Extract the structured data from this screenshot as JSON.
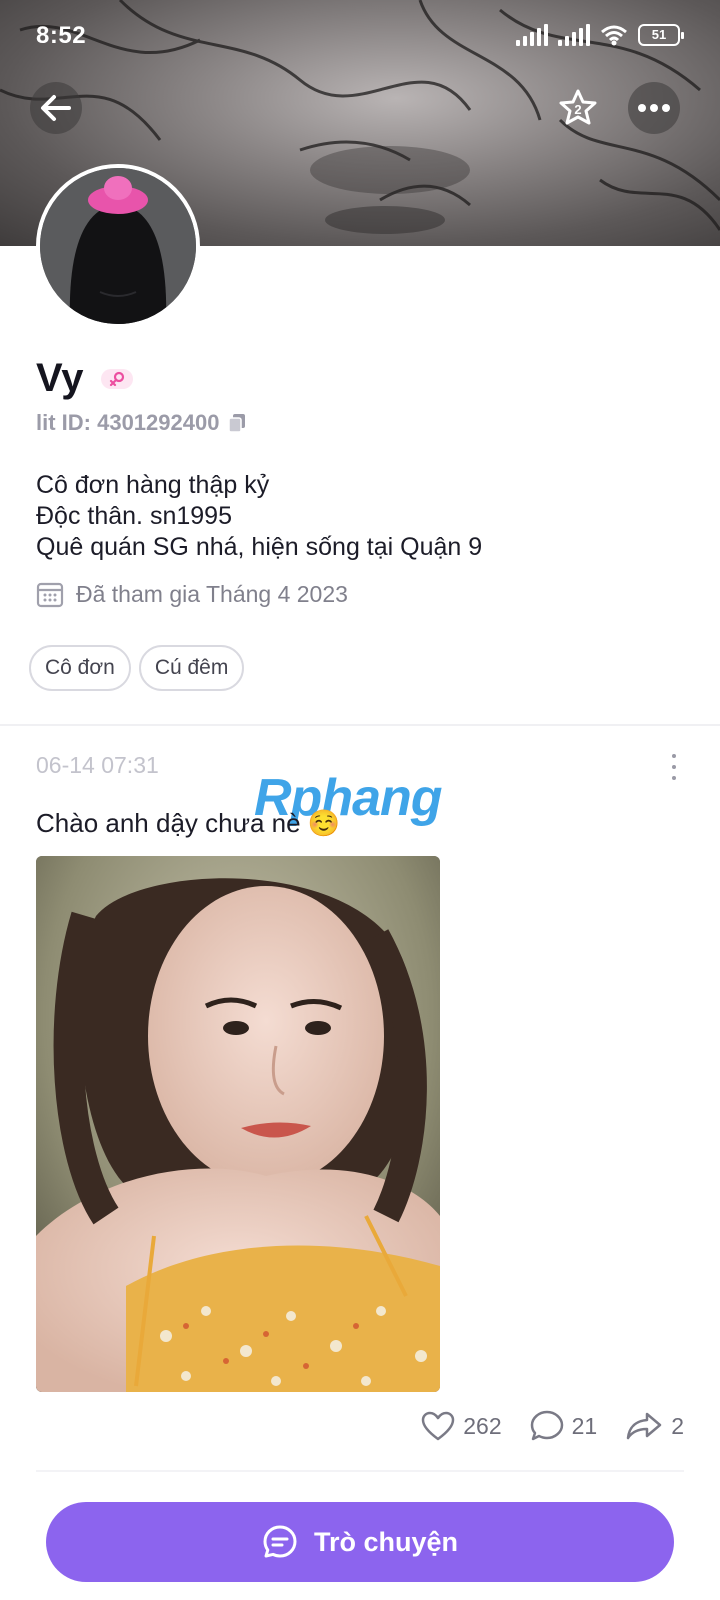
{
  "status_bar": {
    "time": "8:52",
    "battery": "51"
  },
  "header": {
    "back_icon": "arrow-left-icon",
    "favorite_icon": "star-badge-icon",
    "favorite_badge": "2",
    "more_icon": "more-horizontal-icon"
  },
  "profile": {
    "name": "Vy",
    "gender_icon": "female-symbol-icon",
    "lit_id": "lit ID: 4301292400",
    "bio_lines": [
      "Cô đơn hàng thập kỷ",
      "Độc thân. sn1995",
      "Quê quán SG nhá, hiện sống tại Quận 9"
    ],
    "joined": "Đã tham gia Tháng 4 2023",
    "tags": [
      "Cô đơn",
      "Cú đêm"
    ]
  },
  "post": {
    "time": "06-14 07:31",
    "watermark": "Rphang",
    "text": "Chào anh dậy chưa nè ☺️",
    "likes": "262",
    "comments": "21",
    "shares": "2"
  },
  "chat_button": {
    "label": "Trò chuyện"
  },
  "colors": {
    "accent": "#8c64ee",
    "muted": "#9b9ba8",
    "pink": "#ec4fa0"
  }
}
